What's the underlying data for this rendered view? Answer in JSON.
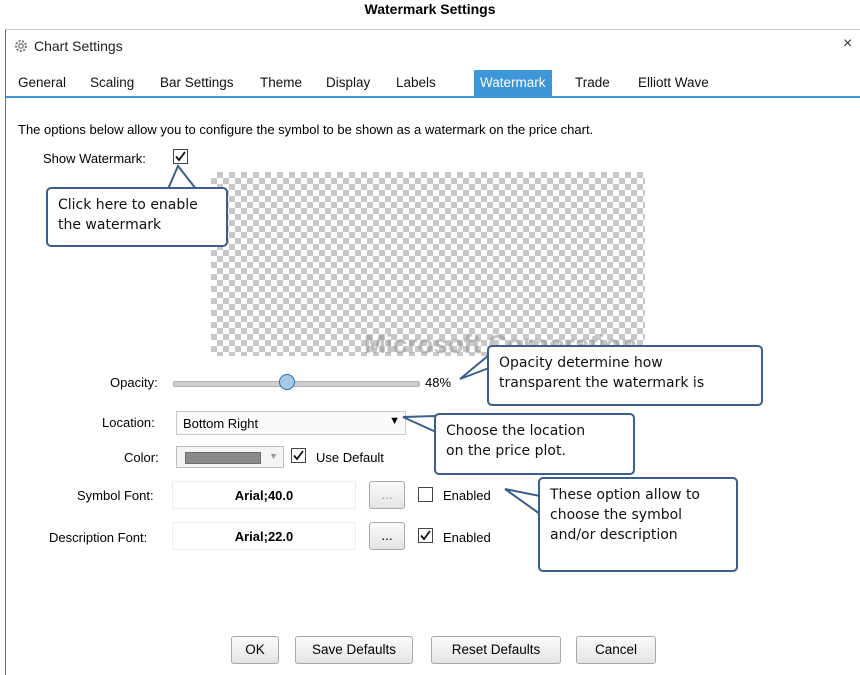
{
  "caption": "Watermark Settings",
  "window": {
    "title": "Chart Settings",
    "close_glyph": "×",
    "icon": "gear-icon"
  },
  "tabs": [
    {
      "label": "General",
      "active": false
    },
    {
      "label": "Scaling",
      "active": false
    },
    {
      "label": "Bar Settings",
      "active": false
    },
    {
      "label": "Theme",
      "active": false
    },
    {
      "label": "Display",
      "active": false
    },
    {
      "label": "Labels",
      "active": false
    },
    {
      "label": "Watermark",
      "active": true
    },
    {
      "label": "Trade",
      "active": false
    },
    {
      "label": "Elliott Wave",
      "active": false
    }
  ],
  "intro": "The options below allow you to configure the symbol to be shown as a watermark on the price chart.",
  "show_watermark": {
    "label": "Show Watermark:",
    "checked": true
  },
  "preview": {
    "watermark_text": "Microsoft Corporation"
  },
  "opacity": {
    "label": "Opacity:",
    "value_text": "48%",
    "value": 0.48
  },
  "location": {
    "label": "Location:",
    "value": "Bottom Right",
    "arrow": "▼"
  },
  "color": {
    "label": "Color:",
    "swatch": "#8a8a8a",
    "arrow": "▼",
    "use_default_label": "Use Default",
    "use_default_checked": true
  },
  "symbol_font": {
    "label": "Symbol Font:",
    "value": "Arial;40.0",
    "button": "...",
    "enabled_label": "Enabled",
    "enabled": false
  },
  "description_font": {
    "label": "Description Font:",
    "value": "Arial;22.0",
    "button": "...",
    "enabled_label": "Enabled",
    "enabled": true
  },
  "footer": {
    "ok": "OK",
    "save_defaults": "Save Defaults",
    "reset_defaults": "Reset Defaults",
    "cancel": "Cancel"
  },
  "callouts": {
    "enable": [
      "Click here to enable",
      "the watermark"
    ],
    "opacity": [
      "Opacity determine how",
      "transparent the watermark is"
    ],
    "location": [
      "Choose the location",
      "on the price plot."
    ],
    "font": [
      "These option allow to",
      "choose the symbol",
      "and/or description"
    ]
  },
  "colors": {
    "accent": "#3c96d8",
    "callout_border": "#3a5f8f"
  }
}
